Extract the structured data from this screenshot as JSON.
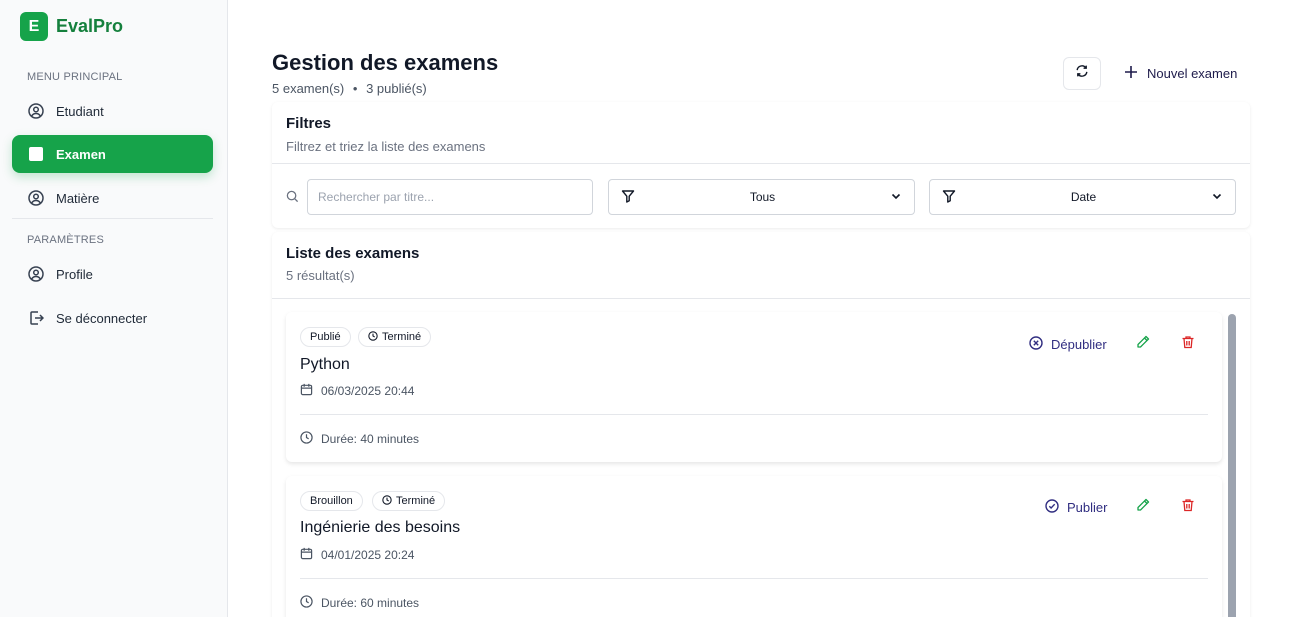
{
  "app": {
    "logo_letter": "E",
    "name": "EvalPro"
  },
  "sidebar": {
    "main_section": "MENU PRINCIPAL",
    "settings_section": "PARAMÈTRES",
    "items": [
      {
        "label": "Etudiant",
        "icon": "user-circle-icon"
      },
      {
        "label": "Examen",
        "icon": "square-icon",
        "active": true
      },
      {
        "label": "Matière",
        "icon": "book-circle-icon"
      }
    ],
    "settings_items": [
      {
        "label": "Profile",
        "icon": "user-circle-icon"
      },
      {
        "label": "Se déconnecter",
        "icon": "logout-icon"
      }
    ]
  },
  "header": {
    "title": "Gestion des examens",
    "subtitle_count": "5 examen(s)",
    "subtitle_sep": "•",
    "subtitle_published": "3 publié(s)",
    "new_button": "Nouvel examen"
  },
  "filters": {
    "title": "Filtres",
    "subtitle": "Filtrez et triez la liste des examens",
    "search_placeholder": "Rechercher par titre...",
    "status_select": "Tous",
    "sort_select": "Date"
  },
  "list": {
    "title": "Liste des examens",
    "subtitle": "5 résultat(s)",
    "exams": [
      {
        "status": "Publié",
        "state": "Terminé",
        "title": "Python",
        "date": "06/03/2025 20:44",
        "duration": "Durée: 40 minutes",
        "action": "Dépublier"
      },
      {
        "status": "Brouillon",
        "state": "Terminé",
        "title": "Ingénierie des besoins",
        "date": "04/01/2025 20:24",
        "duration": "Durée: 60 minutes",
        "action": "Publier"
      }
    ]
  },
  "colors": {
    "brand": "#16a34a",
    "accent": "#312e81",
    "danger": "#dc2626"
  }
}
